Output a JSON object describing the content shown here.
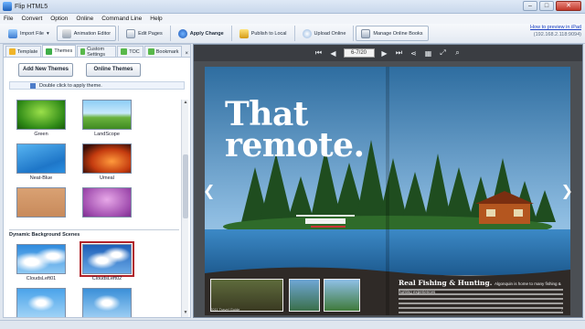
{
  "window": {
    "title": "Flip HTML5",
    "controls": {
      "minimize": "–",
      "maximize": "□",
      "close": "✕"
    }
  },
  "menu": [
    "File",
    "Convert",
    "Option",
    "Online",
    "Command Line",
    "Help"
  ],
  "toolbar": {
    "import": "Import File",
    "animation": "Animation Editor",
    "edit_pages": "Edit Pages",
    "apply": "Apply Change",
    "publish": "Publish to Local",
    "upload": "Upload Online",
    "manage": "Manage Online Books"
  },
  "help": {
    "link": "How to preview in iPad",
    "ip": "(192.168.2.118:9094)"
  },
  "tabs": {
    "template": "Template",
    "themes": "Themes",
    "custom": "Custom Settings",
    "toc": "TOC",
    "bookmark": "Bookmark",
    "close": "×"
  },
  "theme_actions": {
    "add_new": "Add New Themes",
    "online": "Online Themes"
  },
  "hint": "Double click to apply theme.",
  "themes": [
    {
      "name": "Green"
    },
    {
      "name": "LandScope"
    },
    {
      "name": "Neat-Blue"
    },
    {
      "name": "Umeal"
    },
    {
      "name": ""
    },
    {
      "name": ""
    }
  ],
  "dynamic_section": "Dynamic Background Scenes",
  "dynamic": [
    {
      "name": "CloudsLeft01"
    },
    {
      "name": "CloudsLeft02"
    },
    {
      "name": ""
    },
    {
      "name": ""
    }
  ],
  "viewer": {
    "page_indicator": "6-7/20",
    "headline_line1": "That",
    "headline_line2": "remote.",
    "article_title": "Real Fishing & Hunting.",
    "article_lead": "Algonquin is home to many fishing & hunting experiences",
    "footer_left": "2011 Travel Guide",
    "footer_right": "7"
  },
  "colors": {
    "accent_selection": "#b0232a",
    "link": "#1a3fc2",
    "viewer_bg": "#4b4f54"
  }
}
